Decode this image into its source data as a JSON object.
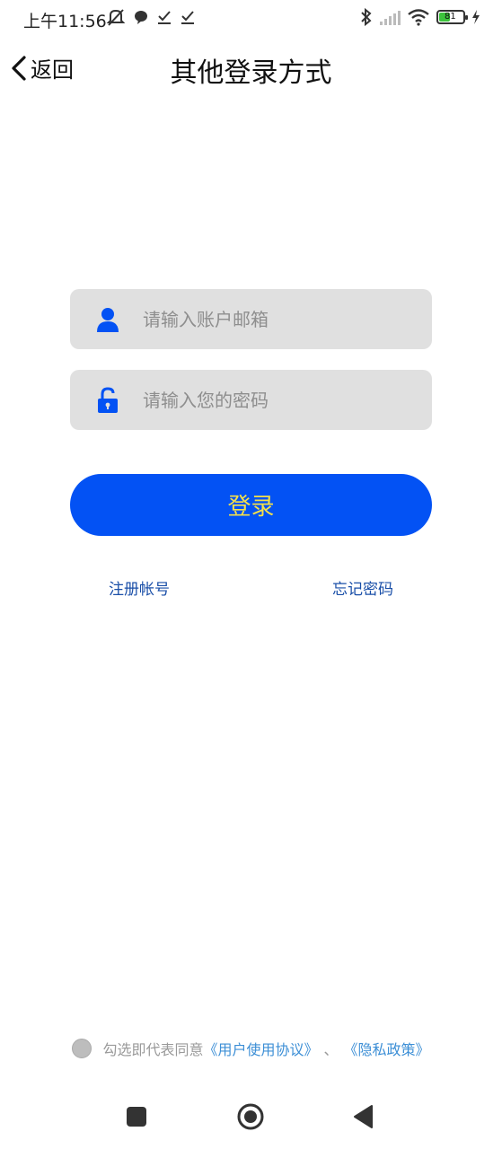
{
  "status_bar": {
    "time": "上午11:56",
    "battery": "81"
  },
  "header": {
    "back_label": "返回",
    "title": "其他登录方式"
  },
  "form": {
    "email_placeholder": "请输入账户邮箱",
    "password_placeholder": "请输入您的密码",
    "login_label": "登录"
  },
  "links": {
    "register": "注册帐号",
    "forgot": "忘记密码"
  },
  "agreement": {
    "text": "勾选即代表同意",
    "user_agreement": "《用户使用协议》",
    "separator": "、",
    "privacy_policy": "《隐私政策》"
  },
  "colors": {
    "accent": "#0352f4",
    "button_text": "#f4e04a",
    "input_bg": "#e0e0e0",
    "link": "#1a4fa8",
    "agreement_link": "#3d8fd6"
  },
  "icons": {
    "email_field": "user-icon",
    "password_field": "unlock-icon"
  }
}
